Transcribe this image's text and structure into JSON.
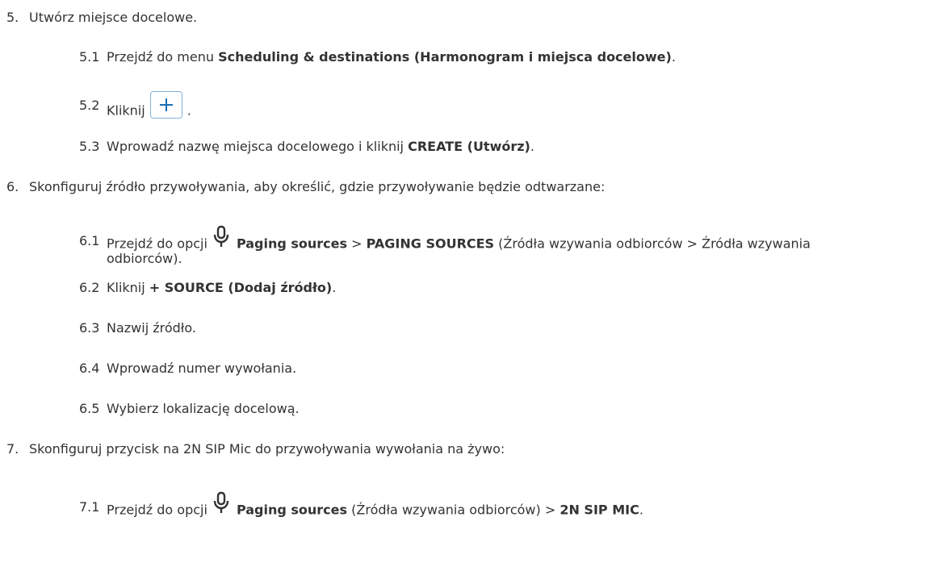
{
  "steps": [
    {
      "num": "5.",
      "text": "Utwórz miejsce docelowe."
    },
    {
      "num": "6.",
      "text": "Skonfiguruj źródło przywoływania, aby określić, gdzie przywoływanie będzie odtwarzane:"
    },
    {
      "num": "7.",
      "text": "Skonfiguruj przycisk na 2N SIP Mic do przywoływania wywołania na żywo:"
    }
  ],
  "s5_1": {
    "num": "5.1",
    "pre": "Przejdź do menu ",
    "bold": "Scheduling & destinations (Harmonogram i miejsca docelowe)",
    "post": "."
  },
  "s5_2": {
    "num": "5.2",
    "pre": "Kliknij",
    "post": "."
  },
  "s5_3": {
    "num": "5.3",
    "pre": "Wprowadź nazwę miejsca docelowego i kliknij ",
    "bold": "CREATE (Utwórz)",
    "post": "."
  },
  "s6_1": {
    "num": "6.1",
    "pre": "Przejdź do opcji",
    "bold1": "Paging sources",
    "mid": " > ",
    "bold2": "PAGING SOURCES",
    "post": " (Źródła wzywania odbiorców > Źródła wzywania",
    "line2": "odbiorców)."
  },
  "s6_2": {
    "num": "6.2",
    "pre": "Kliknij ",
    "bold": "+ SOURCE (Dodaj źródło)",
    "post": "."
  },
  "s6_3": {
    "num": "6.3",
    "text": "Nazwij źródło."
  },
  "s6_4": {
    "num": "6.4",
    "text": "Wprowadź numer wywołania."
  },
  "s6_5": {
    "num": "6.5",
    "text": "Wybierz lokalizację docelową."
  },
  "s7_1": {
    "num": "7.1",
    "pre": "Przejdź do opcji",
    "bold1": "Paging sources",
    "mid": " (Źródła wzywania odbiorców) > ",
    "bold2": "2N SIP MIC",
    "post": "."
  },
  "colors": {
    "button_border": "#7fb3e0",
    "icon_blue": "#1a6fb3",
    "text": "#333333"
  },
  "icons": {
    "add": "plus-icon",
    "mic": "microphone-icon"
  }
}
